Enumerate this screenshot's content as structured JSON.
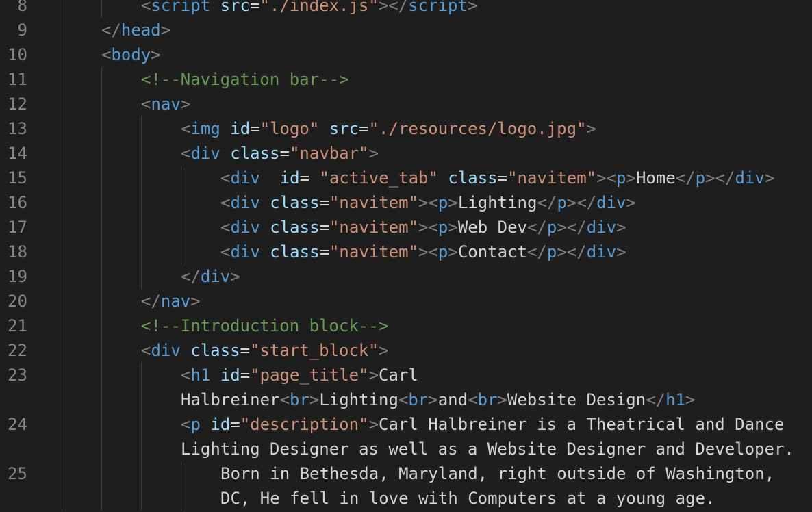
{
  "colors": {
    "background": "#1e1e1e",
    "line_number": "#858585",
    "punctuation": "#808080",
    "tag": "#569cd6",
    "attribute": "#9cdcfe",
    "string": "#ce9178",
    "comment": "#6a9955",
    "text": "#d4d4d4"
  },
  "lines": [
    {
      "n": "8",
      "indent": 2,
      "tokens": [
        {
          "t": "punct",
          "v": "<"
        },
        {
          "t": "tag",
          "v": "script"
        },
        {
          "t": "txt",
          "v": " "
        },
        {
          "t": "attr",
          "v": "src"
        },
        {
          "t": "txt",
          "v": "="
        },
        {
          "t": "str",
          "v": "\"./index.js\""
        },
        {
          "t": "punct",
          "v": "></"
        },
        {
          "t": "tag",
          "v": "script"
        },
        {
          "t": "punct",
          "v": ">"
        }
      ]
    },
    {
      "n": "9",
      "indent": 1,
      "tokens": [
        {
          "t": "punct",
          "v": "</"
        },
        {
          "t": "tag",
          "v": "head"
        },
        {
          "t": "punct",
          "v": ">"
        }
      ]
    },
    {
      "n": "10",
      "indent": 1,
      "tokens": [
        {
          "t": "punct",
          "v": "<"
        },
        {
          "t": "tag",
          "v": "body"
        },
        {
          "t": "punct",
          "v": ">"
        }
      ]
    },
    {
      "n": "11",
      "indent": 2,
      "tokens": [
        {
          "t": "cmt",
          "v": "<!--Navigation bar-->"
        }
      ]
    },
    {
      "n": "12",
      "indent": 2,
      "tokens": [
        {
          "t": "punct",
          "v": "<"
        },
        {
          "t": "tag",
          "v": "nav"
        },
        {
          "t": "punct",
          "v": ">"
        }
      ]
    },
    {
      "n": "13",
      "indent": 3,
      "tokens": [
        {
          "t": "punct",
          "v": "<"
        },
        {
          "t": "tag",
          "v": "img"
        },
        {
          "t": "txt",
          "v": " "
        },
        {
          "t": "attr",
          "v": "id"
        },
        {
          "t": "txt",
          "v": "="
        },
        {
          "t": "str",
          "v": "\"logo\""
        },
        {
          "t": "txt",
          "v": " "
        },
        {
          "t": "attr",
          "v": "src"
        },
        {
          "t": "txt",
          "v": "="
        },
        {
          "t": "str",
          "v": "\"./resources/logo.jpg\""
        },
        {
          "t": "punct",
          "v": ">"
        }
      ]
    },
    {
      "n": "14",
      "indent": 3,
      "tokens": [
        {
          "t": "punct",
          "v": "<"
        },
        {
          "t": "tag",
          "v": "div"
        },
        {
          "t": "txt",
          "v": " "
        },
        {
          "t": "attr",
          "v": "class"
        },
        {
          "t": "txt",
          "v": "="
        },
        {
          "t": "str",
          "v": "\"navbar\""
        },
        {
          "t": "punct",
          "v": ">"
        }
      ]
    },
    {
      "n": "15",
      "indent": 4,
      "tokens": [
        {
          "t": "punct",
          "v": "<"
        },
        {
          "t": "tag",
          "v": "div"
        },
        {
          "t": "txt",
          "v": "  "
        },
        {
          "t": "attr",
          "v": "id"
        },
        {
          "t": "txt",
          "v": "= "
        },
        {
          "t": "str",
          "v": "\"active_tab\""
        },
        {
          "t": "txt",
          "v": " "
        },
        {
          "t": "attr",
          "v": "class"
        },
        {
          "t": "txt",
          "v": "="
        },
        {
          "t": "str",
          "v": "\"navitem\""
        },
        {
          "t": "punct",
          "v": "><"
        },
        {
          "t": "tag",
          "v": "p"
        },
        {
          "t": "punct",
          "v": ">"
        },
        {
          "t": "txt",
          "v": "Home"
        },
        {
          "t": "punct",
          "v": "</"
        },
        {
          "t": "tag",
          "v": "p"
        },
        {
          "t": "punct",
          "v": "></"
        },
        {
          "t": "tag",
          "v": "div"
        },
        {
          "t": "punct",
          "v": ">"
        }
      ]
    },
    {
      "n": "16",
      "indent": 4,
      "tokens": [
        {
          "t": "punct",
          "v": "<"
        },
        {
          "t": "tag",
          "v": "div"
        },
        {
          "t": "txt",
          "v": " "
        },
        {
          "t": "attr",
          "v": "class"
        },
        {
          "t": "txt",
          "v": "="
        },
        {
          "t": "str",
          "v": "\"navitem\""
        },
        {
          "t": "punct",
          "v": "><"
        },
        {
          "t": "tag",
          "v": "p"
        },
        {
          "t": "punct",
          "v": ">"
        },
        {
          "t": "txt",
          "v": "Lighting"
        },
        {
          "t": "punct",
          "v": "</"
        },
        {
          "t": "tag",
          "v": "p"
        },
        {
          "t": "punct",
          "v": "></"
        },
        {
          "t": "tag",
          "v": "div"
        },
        {
          "t": "punct",
          "v": ">"
        }
      ]
    },
    {
      "n": "17",
      "indent": 4,
      "tokens": [
        {
          "t": "punct",
          "v": "<"
        },
        {
          "t": "tag",
          "v": "div"
        },
        {
          "t": "txt",
          "v": " "
        },
        {
          "t": "attr",
          "v": "class"
        },
        {
          "t": "txt",
          "v": "="
        },
        {
          "t": "str",
          "v": "\"navitem\""
        },
        {
          "t": "punct",
          "v": "><"
        },
        {
          "t": "tag",
          "v": "p"
        },
        {
          "t": "punct",
          "v": ">"
        },
        {
          "t": "txt",
          "v": "Web Dev"
        },
        {
          "t": "punct",
          "v": "</"
        },
        {
          "t": "tag",
          "v": "p"
        },
        {
          "t": "punct",
          "v": "></"
        },
        {
          "t": "tag",
          "v": "div"
        },
        {
          "t": "punct",
          "v": ">"
        }
      ]
    },
    {
      "n": "18",
      "indent": 4,
      "tokens": [
        {
          "t": "punct",
          "v": "<"
        },
        {
          "t": "tag",
          "v": "div"
        },
        {
          "t": "txt",
          "v": " "
        },
        {
          "t": "attr",
          "v": "class"
        },
        {
          "t": "txt",
          "v": "="
        },
        {
          "t": "str",
          "v": "\"navitem\""
        },
        {
          "t": "punct",
          "v": "><"
        },
        {
          "t": "tag",
          "v": "p"
        },
        {
          "t": "punct",
          "v": ">"
        },
        {
          "t": "txt",
          "v": "Contact"
        },
        {
          "t": "punct",
          "v": "</"
        },
        {
          "t": "tag",
          "v": "p"
        },
        {
          "t": "punct",
          "v": "></"
        },
        {
          "t": "tag",
          "v": "div"
        },
        {
          "t": "punct",
          "v": ">"
        }
      ]
    },
    {
      "n": "19",
      "indent": 3,
      "tokens": [
        {
          "t": "punct",
          "v": "</"
        },
        {
          "t": "tag",
          "v": "div"
        },
        {
          "t": "punct",
          "v": ">"
        }
      ]
    },
    {
      "n": "20",
      "indent": 2,
      "tokens": [
        {
          "t": "punct",
          "v": "</"
        },
        {
          "t": "tag",
          "v": "nav"
        },
        {
          "t": "punct",
          "v": ">"
        }
      ]
    },
    {
      "n": "21",
      "indent": 2,
      "tokens": [
        {
          "t": "cmt",
          "v": "<!--Introduction block-->"
        }
      ]
    },
    {
      "n": "22",
      "indent": 2,
      "tokens": [
        {
          "t": "punct",
          "v": "<"
        },
        {
          "t": "tag",
          "v": "div"
        },
        {
          "t": "txt",
          "v": " "
        },
        {
          "t": "attr",
          "v": "class"
        },
        {
          "t": "txt",
          "v": "="
        },
        {
          "t": "str",
          "v": "\"start_block\""
        },
        {
          "t": "punct",
          "v": ">"
        }
      ]
    },
    {
      "n": "23",
      "indent": 3,
      "tokens": [
        {
          "t": "punct",
          "v": "<"
        },
        {
          "t": "tag",
          "v": "h1"
        },
        {
          "t": "txt",
          "v": " "
        },
        {
          "t": "attr",
          "v": "id"
        },
        {
          "t": "txt",
          "v": "="
        },
        {
          "t": "str",
          "v": "\"page_title\""
        },
        {
          "t": "punct",
          "v": ">"
        },
        {
          "t": "txt",
          "v": "Carl"
        }
      ]
    },
    {
      "n": "",
      "indent": 3,
      "tokens": [
        {
          "t": "txt",
          "v": "Halbreiner"
        },
        {
          "t": "punct",
          "v": "<"
        },
        {
          "t": "tag",
          "v": "br"
        },
        {
          "t": "punct",
          "v": ">"
        },
        {
          "t": "txt",
          "v": "Lighting"
        },
        {
          "t": "punct",
          "v": "<"
        },
        {
          "t": "tag",
          "v": "br"
        },
        {
          "t": "punct",
          "v": ">"
        },
        {
          "t": "txt",
          "v": "and"
        },
        {
          "t": "punct",
          "v": "<"
        },
        {
          "t": "tag",
          "v": "br"
        },
        {
          "t": "punct",
          "v": ">"
        },
        {
          "t": "txt",
          "v": "Website Design"
        },
        {
          "t": "punct",
          "v": "</"
        },
        {
          "t": "tag",
          "v": "h1"
        },
        {
          "t": "punct",
          "v": ">"
        }
      ]
    },
    {
      "n": "24",
      "indent": 3,
      "tokens": [
        {
          "t": "punct",
          "v": "<"
        },
        {
          "t": "tag",
          "v": "p"
        },
        {
          "t": "txt",
          "v": " "
        },
        {
          "t": "attr",
          "v": "id"
        },
        {
          "t": "txt",
          "v": "="
        },
        {
          "t": "str",
          "v": "\"description\""
        },
        {
          "t": "punct",
          "v": ">"
        },
        {
          "t": "txt",
          "v": "Carl Halbreiner is a Theatrical and Dance"
        }
      ]
    },
    {
      "n": "",
      "indent": 3,
      "tokens": [
        {
          "t": "txt",
          "v": "Lighting Designer as well as a Website Designer and Developer."
        }
      ]
    },
    {
      "n": "25",
      "indent": 4,
      "tokens": [
        {
          "t": "txt",
          "v": "Born in Bethesda, Maryland, right outside of Washington,"
        }
      ]
    },
    {
      "n": "",
      "indent": 4,
      "tokens": [
        {
          "t": "txt",
          "v": "DC, He fell in love with Computers at a young age."
        }
      ]
    }
  ]
}
